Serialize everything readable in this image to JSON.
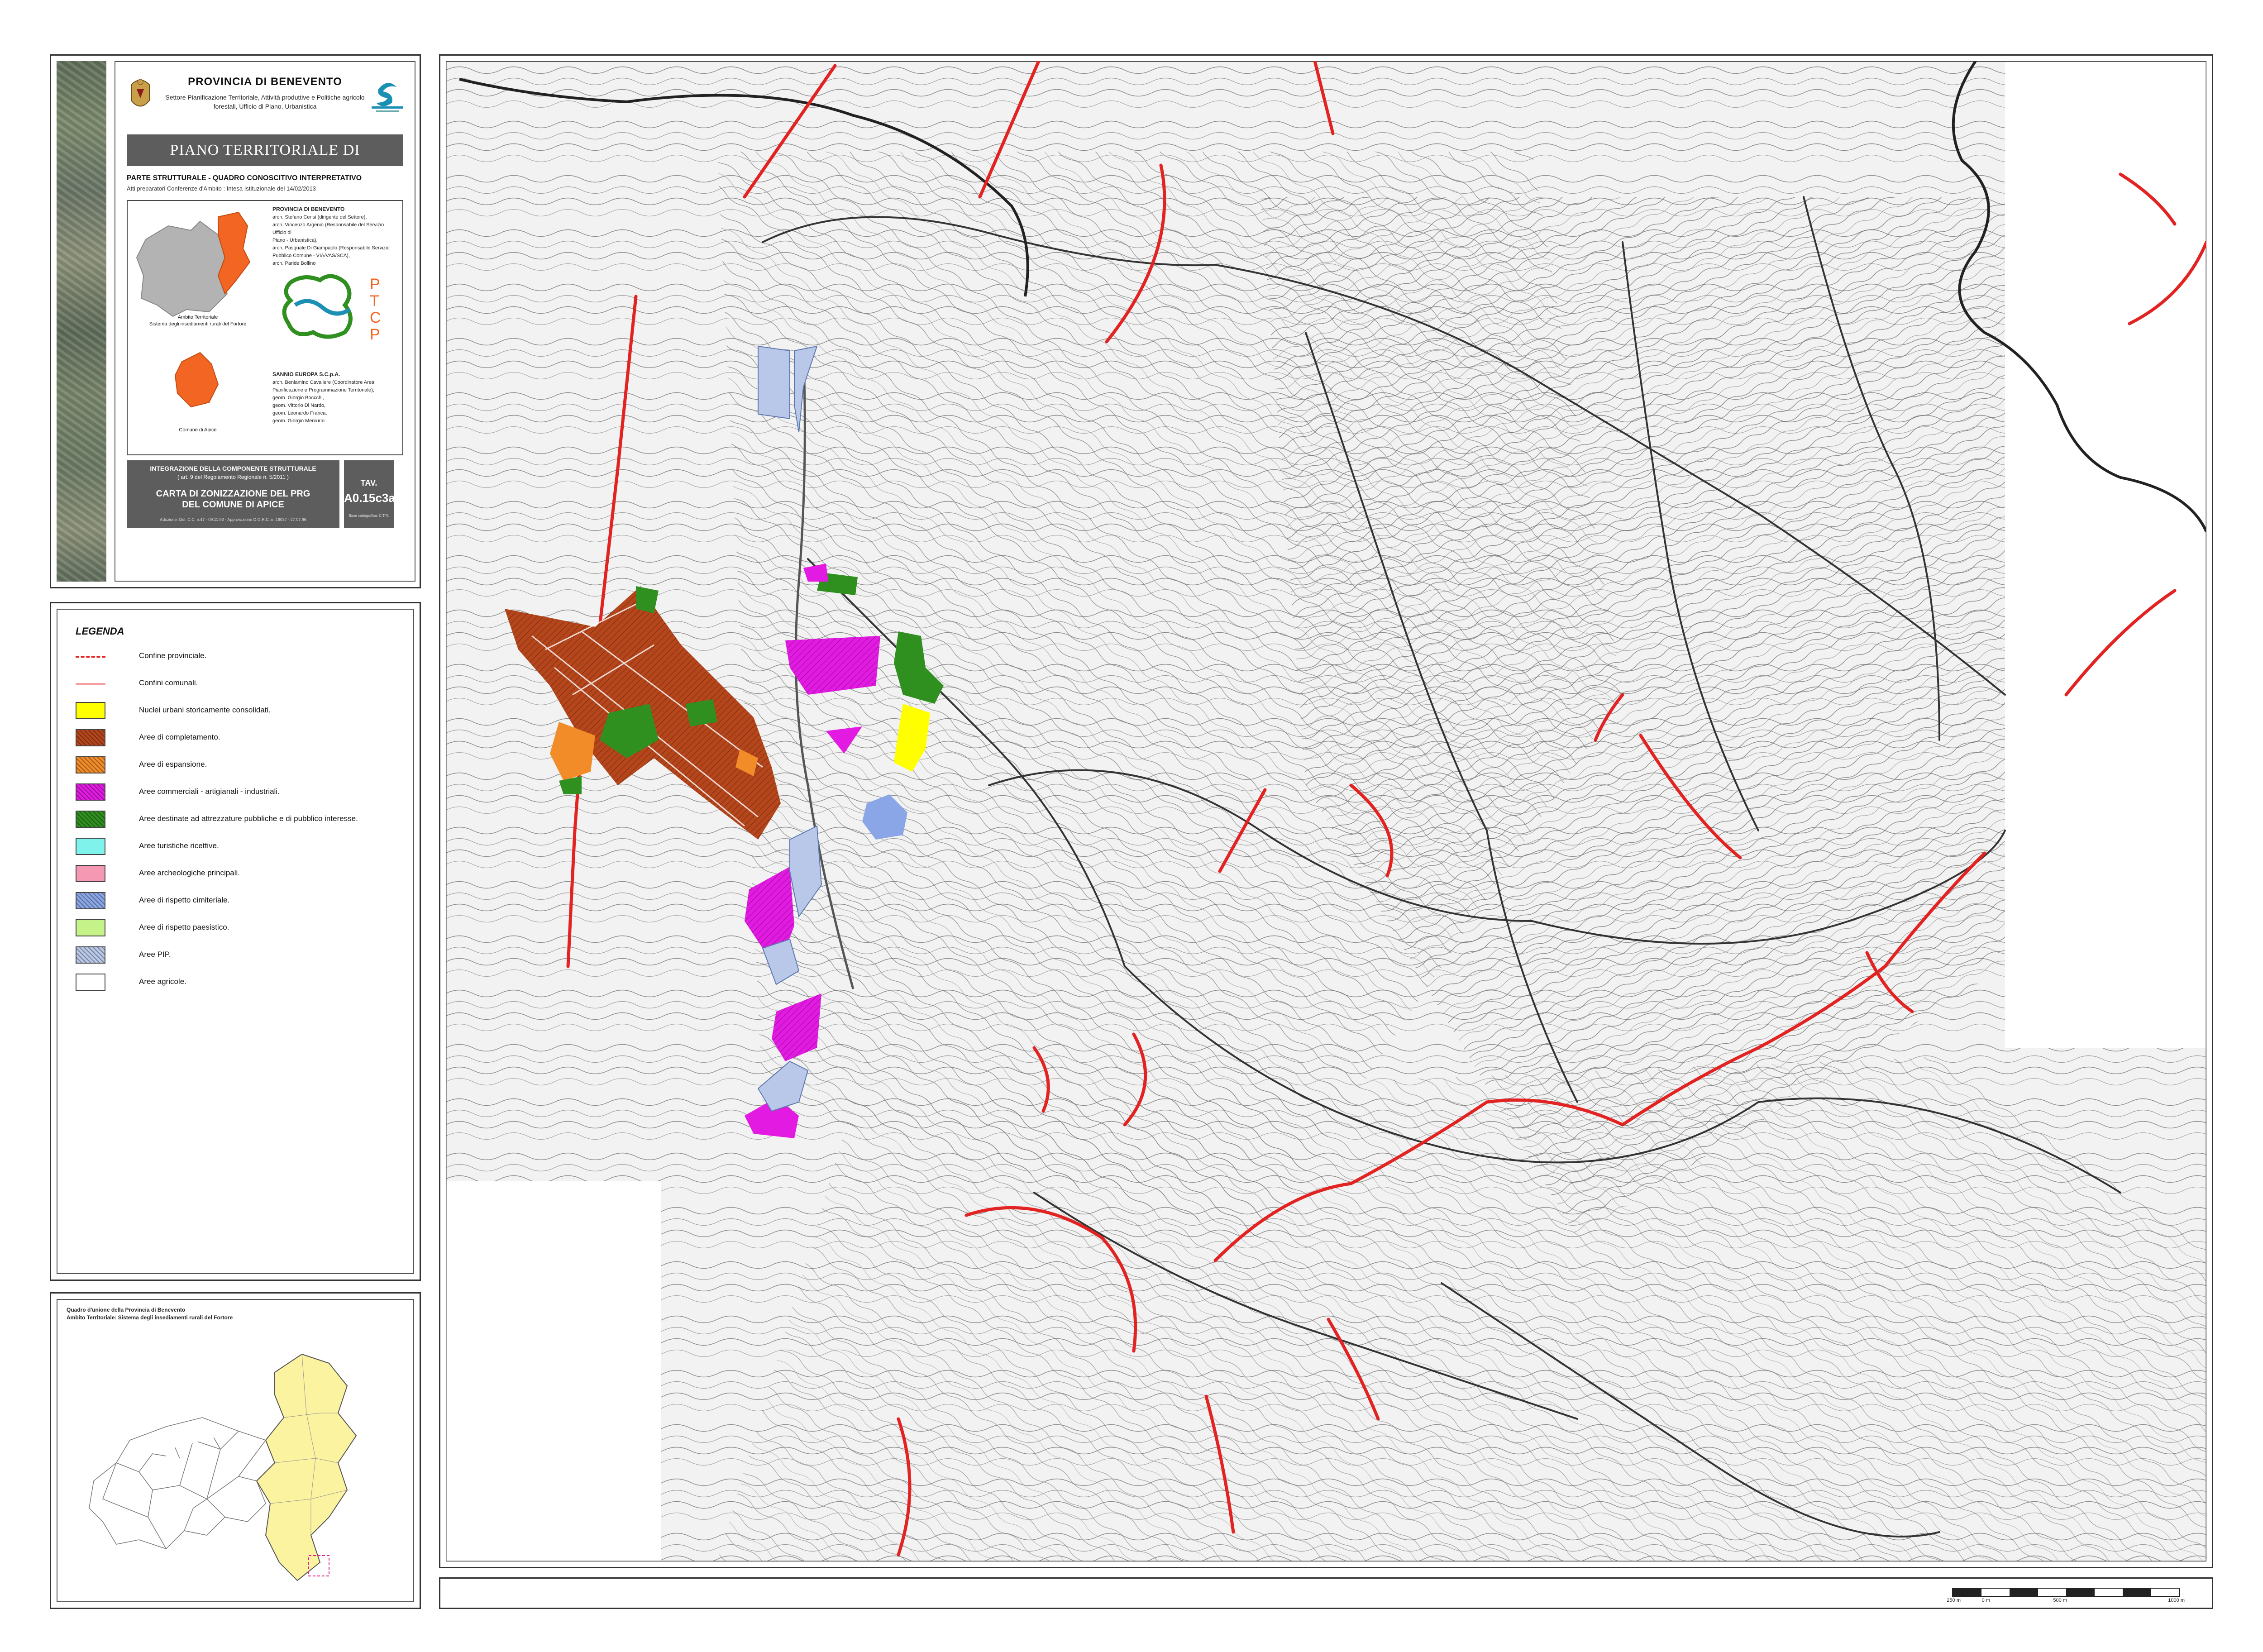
{
  "title_block": {
    "province": "PROVINCIA DI BENEVENTO",
    "department": "Settore Pianificazione Territoriale, Attività produttive e Politiche agricolo forestali, Ufficio di Piano, Urbanistica",
    "plan_name": "PIANO TERRITORIALE DI COORDINAMENTO PROVINCIALE",
    "part_title": "PARTE STRUTTURALE - QUADRO CONOSCITIVO INTERPRETATIVO",
    "part_subtitle": "Atti preparatori Conferenze d'Ambito : Intesa Istituzionale del 14/02/2013",
    "inset_caption_ambito_1": "Ambito Territoriale",
    "inset_caption_ambito_2": "Sistema degli insediamenti rurali del Fortore",
    "inset_caption_comune": "Comune di Apice",
    "ptcp_letters": [
      "P",
      "T",
      "C",
      "P"
    ],
    "credits_1_title": "PROVINCIA DI BENEVENTO",
    "credits_1_lines": [
      "arch. Stefano Cerisi (dirigente del Settore),",
      "arch. Vincenzo Argenio (Responsabile del Servizio Ufficio di",
      "Piano - Urbanistica),",
      "arch. Pasquale Di Giampaolo (Responsabile Servizio",
      "Pubblico Comune - VIA/VAS/SCA),",
      "arch. Paride Bollino"
    ],
    "credits_2_title": "SANNIO EUROPA S.C.p.A.",
    "credits_2_lines": [
      "arch. Beniamino Cavaliere (Coordinatore Area",
      "Pianificazione e Programmazione Territoriale),",
      "geom. Giorgio Boccchi,",
      "geom. Vittorio Di Nardo,",
      "geom. Leonardo Franca,",
      "geom. Giorgio Mercurio"
    ],
    "integration_line_1": "INTEGRAZIONE DELLA COMPONENTE STRUTTURALE",
    "integration_line_2": "( art. 9 del Regolamento Regionale n. 5/2011 )",
    "map_title_1": "CARTA DI ZONIZZAZIONE DEL PRG",
    "map_title_2": "DEL COMUNE DI APICE",
    "approval_note": "Adozione: Del. C.C. n.47 - 09.11.93 - Approvazione D.G.R.C. n. 18037 - 27.07.96",
    "tav_label": "TAV.",
    "tav_number": "A0.15c3a",
    "tav_small": "Base cartografica: C.T.R."
  },
  "legend": {
    "title": "LEGENDA",
    "items": [
      {
        "label": "Confine provinciale.",
        "kind": "line",
        "color": "#e32222",
        "style": "dashed"
      },
      {
        "label": "Confini comunali.",
        "kind": "line",
        "color": "#f4a0a0",
        "style": "solid"
      },
      {
        "label": "Nuclei urbani storicamente consolidati.",
        "kind": "fill",
        "color": "#ffff00",
        "hatch": false
      },
      {
        "label": "Aree di completamento.",
        "kind": "fill",
        "color": "#b5451b",
        "hatch": true
      },
      {
        "label": "Aree di espansione.",
        "kind": "fill",
        "color": "#f28c28",
        "hatch": true
      },
      {
        "label": "Aree commerciali - artigianali - industriali.",
        "kind": "fill",
        "color": "#e21ae2",
        "hatch": true
      },
      {
        "label": "Aree destinate ad attrezzature pubbliche e di pubblico interesse.",
        "kind": "fill",
        "color": "#2f8f1f",
        "hatch": true
      },
      {
        "label": "Aree turistiche ricettive.",
        "kind": "fill",
        "color": "#7ff2ec",
        "hatch": false
      },
      {
        "label": "Aree archeologiche principali.",
        "kind": "fill",
        "color": "#f598b4",
        "hatch": false
      },
      {
        "label": "Aree di rispetto cimiteriale.",
        "kind": "fill",
        "color": "#8aa6e6",
        "hatch": true
      },
      {
        "label": "Aree di rispetto paesistico.",
        "kind": "fill",
        "color": "#c6f28a",
        "hatch": false
      },
      {
        "label": "Aree PIP.",
        "kind": "fill",
        "color": "#b9c8e8",
        "hatch": true
      },
      {
        "label": "Aree agricole.",
        "kind": "fill",
        "color": "#ffffff",
        "hatch": false
      }
    ]
  },
  "overview": {
    "title_1": "Quadro d'unione della Provincia di Benevento",
    "title_2": "Ambito Territoriale: Sistema degli insediamenti rurali del Fortore",
    "highlight_color": "#fbf3a0"
  },
  "map": {
    "zone_colors": {
      "completamento": "#b5451b",
      "espansione": "#f28c28",
      "commerciali": "#e21ae2",
      "attrezzature": "#2f8f1f",
      "nuclei": "#ffff00",
      "cimiteriale": "#8aa6e6",
      "pip": "#b9c8e8",
      "boundary": "#e32222"
    }
  },
  "scale": {
    "labels": [
      "250 m",
      "0 m",
      "500 m",
      "1000 m"
    ]
  }
}
